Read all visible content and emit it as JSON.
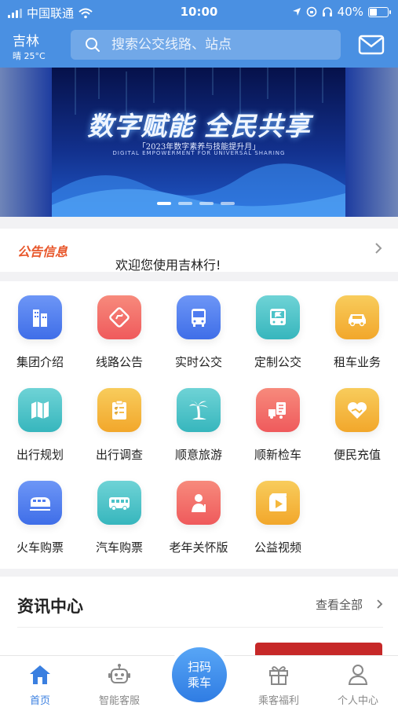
{
  "status": {
    "carrier": "中国联通",
    "time": "10:00",
    "battery": "40%",
    "battery_level": 0.4
  },
  "header": {
    "city": "吉林",
    "weather": "晴 25°C",
    "search_placeholder": "搜索公交线路、站点"
  },
  "banner": {
    "title": "数字赋能 全民共享",
    "subtitle": "「2023年数字素养与技能提升月」",
    "subtitle_en": "DIGITAL EMPOWERMENT FOR UNIVERSAL SHARING",
    "slides": 4,
    "active": 0
  },
  "notice": {
    "tag": "公告信息",
    "text": "欢迎您使用吉林行!"
  },
  "services": [
    {
      "label": "集团介绍",
      "icon": "building-icon",
      "color": "#4e7bf0"
    },
    {
      "label": "线路公告",
      "icon": "route-sign-icon",
      "color": "#f26d6a"
    },
    {
      "label": "实时公交",
      "icon": "bus-front-icon",
      "color": "#4e7bf0"
    },
    {
      "label": "定制公交",
      "icon": "bus-flag-icon",
      "color": "#4cc3c8"
    },
    {
      "label": "租车业务",
      "icon": "car-icon",
      "color": "#f5b83d"
    },
    {
      "label": "出行规划",
      "icon": "map-icon",
      "color": "#4cc3c8"
    },
    {
      "label": "出行调查",
      "icon": "clipboard-icon",
      "color": "#f5b83d"
    },
    {
      "label": "顺意旅游",
      "icon": "palm-tree-icon",
      "color": "#4cc3c8"
    },
    {
      "label": "顺新检车",
      "icon": "inspection-truck-icon",
      "color": "#f26d6a"
    },
    {
      "label": "便民充值",
      "icon": "heart-hand-icon",
      "color": "#f5b83d"
    },
    {
      "label": "火车购票",
      "icon": "train-icon",
      "color": "#4e7bf0"
    },
    {
      "label": "汽车购票",
      "icon": "coach-icon",
      "color": "#4cc3c8"
    },
    {
      "label": "老年关怀版",
      "icon": "elder-icon",
      "color": "#f26d6a"
    },
    {
      "label": "公益视频",
      "icon": "video-icon",
      "color": "#f5b83d"
    }
  ],
  "news": {
    "title": "资讯中心",
    "more": "查看全部"
  },
  "tabs": [
    {
      "label": "首页",
      "icon": "home-icon"
    },
    {
      "label": "智能客服",
      "icon": "robot-icon"
    },
    {
      "label": "乘客福利",
      "icon": "gift-icon"
    },
    {
      "label": "个人中心",
      "icon": "user-icon"
    }
  ],
  "scan": {
    "line1": "扫码",
    "line2": "乘车"
  },
  "colors": {
    "primary": "#4a90e2",
    "accent": "#e8572b",
    "active_tab": "#3a7fe0"
  }
}
